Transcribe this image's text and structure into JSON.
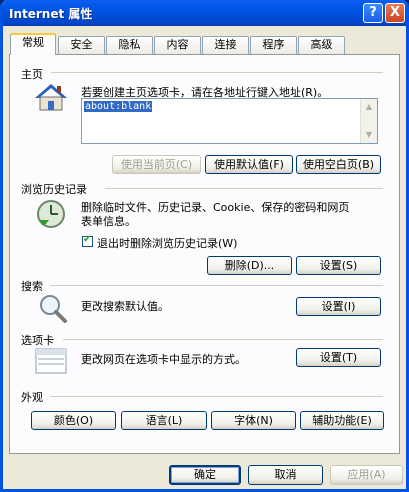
{
  "window": {
    "title": "Internet 属性",
    "help": "?",
    "close": "X"
  },
  "tabs": [
    "常规",
    "安全",
    "隐私",
    "内容",
    "连接",
    "程序",
    "高级"
  ],
  "home": {
    "heading": "主页",
    "instruction": "若要创建主页选项卡，请在各地址行键入地址(R)。",
    "url": "about:blank",
    "use_current": "使用当前页(C)",
    "use_default": "使用默认值(F)",
    "use_blank": "使用空白页(B)"
  },
  "history": {
    "heading": "浏览历史记录",
    "desc_line1": "删除临时文件、历史记录、Cookie、保存的密码和网页",
    "desc_line2": "表单信息。",
    "checkbox": "退出时删除浏览历史记录(W)",
    "delete": "删除(D)...",
    "settings": "设置(S)"
  },
  "search": {
    "heading": "搜索",
    "desc": "更改搜索默认值。",
    "settings": "设置(I)"
  },
  "tabs_section": {
    "heading": "选项卡",
    "desc": "更改网页在选项卡中显示的方式。",
    "settings": "设置(T)"
  },
  "appearance": {
    "heading": "外观",
    "colors": "颜色(O)",
    "languages": "语言(L)",
    "fonts": "字体(N)",
    "accessibility": "辅助功能(E)"
  },
  "footer": {
    "ok": "确定",
    "cancel": "取消",
    "apply": "应用(A)"
  }
}
